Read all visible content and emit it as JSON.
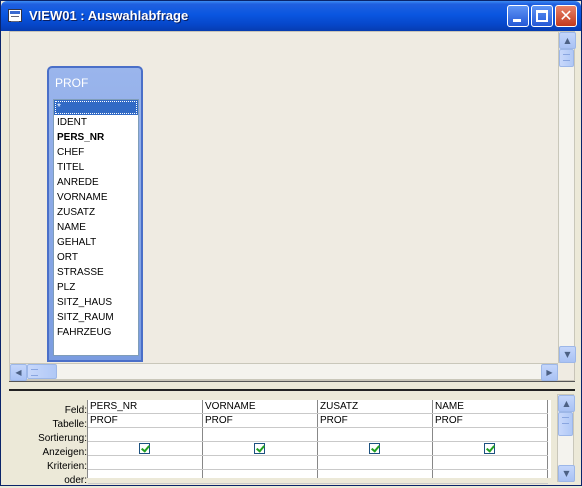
{
  "window": {
    "title": "VIEW01 : Auswahlabfrage"
  },
  "table": {
    "name": "PROF",
    "fields": [
      "*",
      "IDENT",
      "PERS_NR",
      "CHEF",
      "TITEL",
      "ANREDE",
      "VORNAME",
      "ZUSATZ",
      "NAME",
      "GEHALT",
      "ORT",
      "STRASSE",
      "PLZ",
      "SITZ_HAUS",
      "SITZ_RAUM",
      "FAHRZEUG"
    ],
    "selected_field": "*",
    "key_field": "PERS_NR"
  },
  "grid": {
    "row_labels": {
      "feld": "Feld:",
      "tabelle": "Tabelle:",
      "sortierung": "Sortierung:",
      "anzeigen": "Anzeigen:",
      "kriterien": "Kriterien:",
      "oder": "oder:"
    },
    "columns": [
      {
        "feld": "PERS_NR",
        "tabelle": "PROF",
        "sortierung": "",
        "anzeigen": true,
        "kriterien": ""
      },
      {
        "feld": "VORNAME",
        "tabelle": "PROF",
        "sortierung": "",
        "anzeigen": true,
        "kriterien": ""
      },
      {
        "feld": "ZUSATZ",
        "tabelle": "PROF",
        "sortierung": "",
        "anzeigen": true,
        "kriterien": ""
      },
      {
        "feld": "NAME",
        "tabelle": "PROF",
        "sortierung": "",
        "anzeigen": true,
        "kriterien": ""
      }
    ]
  },
  "icons": {
    "app": "query-window-icon",
    "minimize": "minimize-icon",
    "maximize": "maximize-icon",
    "close": "close-icon"
  },
  "colors": {
    "titlebar": "#0a56e0",
    "selection": "#316ac5",
    "table_header": "#7a9ce0",
    "check": "#21a121"
  }
}
